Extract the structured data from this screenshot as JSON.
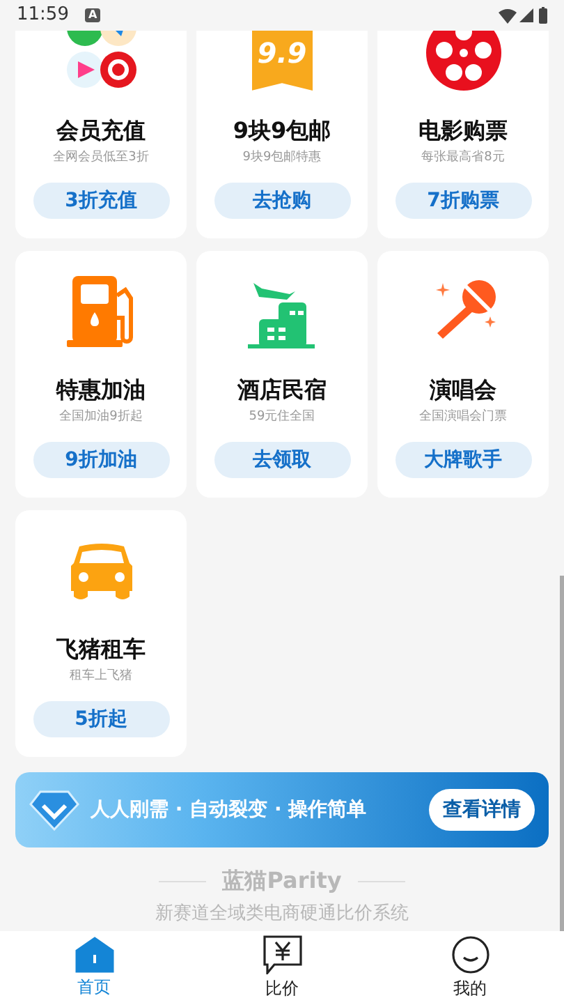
{
  "status_bar": {
    "time": "11:59",
    "notification": "A"
  },
  "services": [
    {
      "kind": "apps",
      "title": "会员充值",
      "subtitle": "全网会员低至3折",
      "action": "3折充值"
    },
    {
      "kind": "tag",
      "tag_text": "9.9",
      "title": "9块9包邮",
      "subtitle": "9块9包邮特惠",
      "action": "去抢购"
    },
    {
      "kind": "film",
      "title": "电影购票",
      "subtitle": "每张最高省8元",
      "action": "7折购票"
    },
    {
      "kind": "fuel",
      "title": "特惠加油",
      "subtitle": "全国加油9折起",
      "action": "9折加油"
    },
    {
      "kind": "hotel",
      "title": "酒店民宿",
      "subtitle": "59元住全国",
      "action": "去领取"
    },
    {
      "kind": "mic",
      "title": "演唱会",
      "subtitle": "全国演唱会门票",
      "action": "大牌歌手"
    },
    {
      "kind": "car",
      "title": "飞猪租车",
      "subtitle": "租车上飞猪",
      "action": "5折起"
    }
  ],
  "banner": {
    "text": "人人刚需 · 自动裂变 · 操作简单",
    "button": "查看详情"
  },
  "footer": {
    "brand": "蓝猫Parity",
    "tagline": "新赛道全域类电商硬通比价系统"
  },
  "tab_bar": [
    {
      "kind": "home",
      "label": "首页",
      "selected": true
    },
    {
      "kind": "price",
      "label": "比价",
      "selected": false
    },
    {
      "kind": "face",
      "label": "我的",
      "selected": false
    }
  ]
}
